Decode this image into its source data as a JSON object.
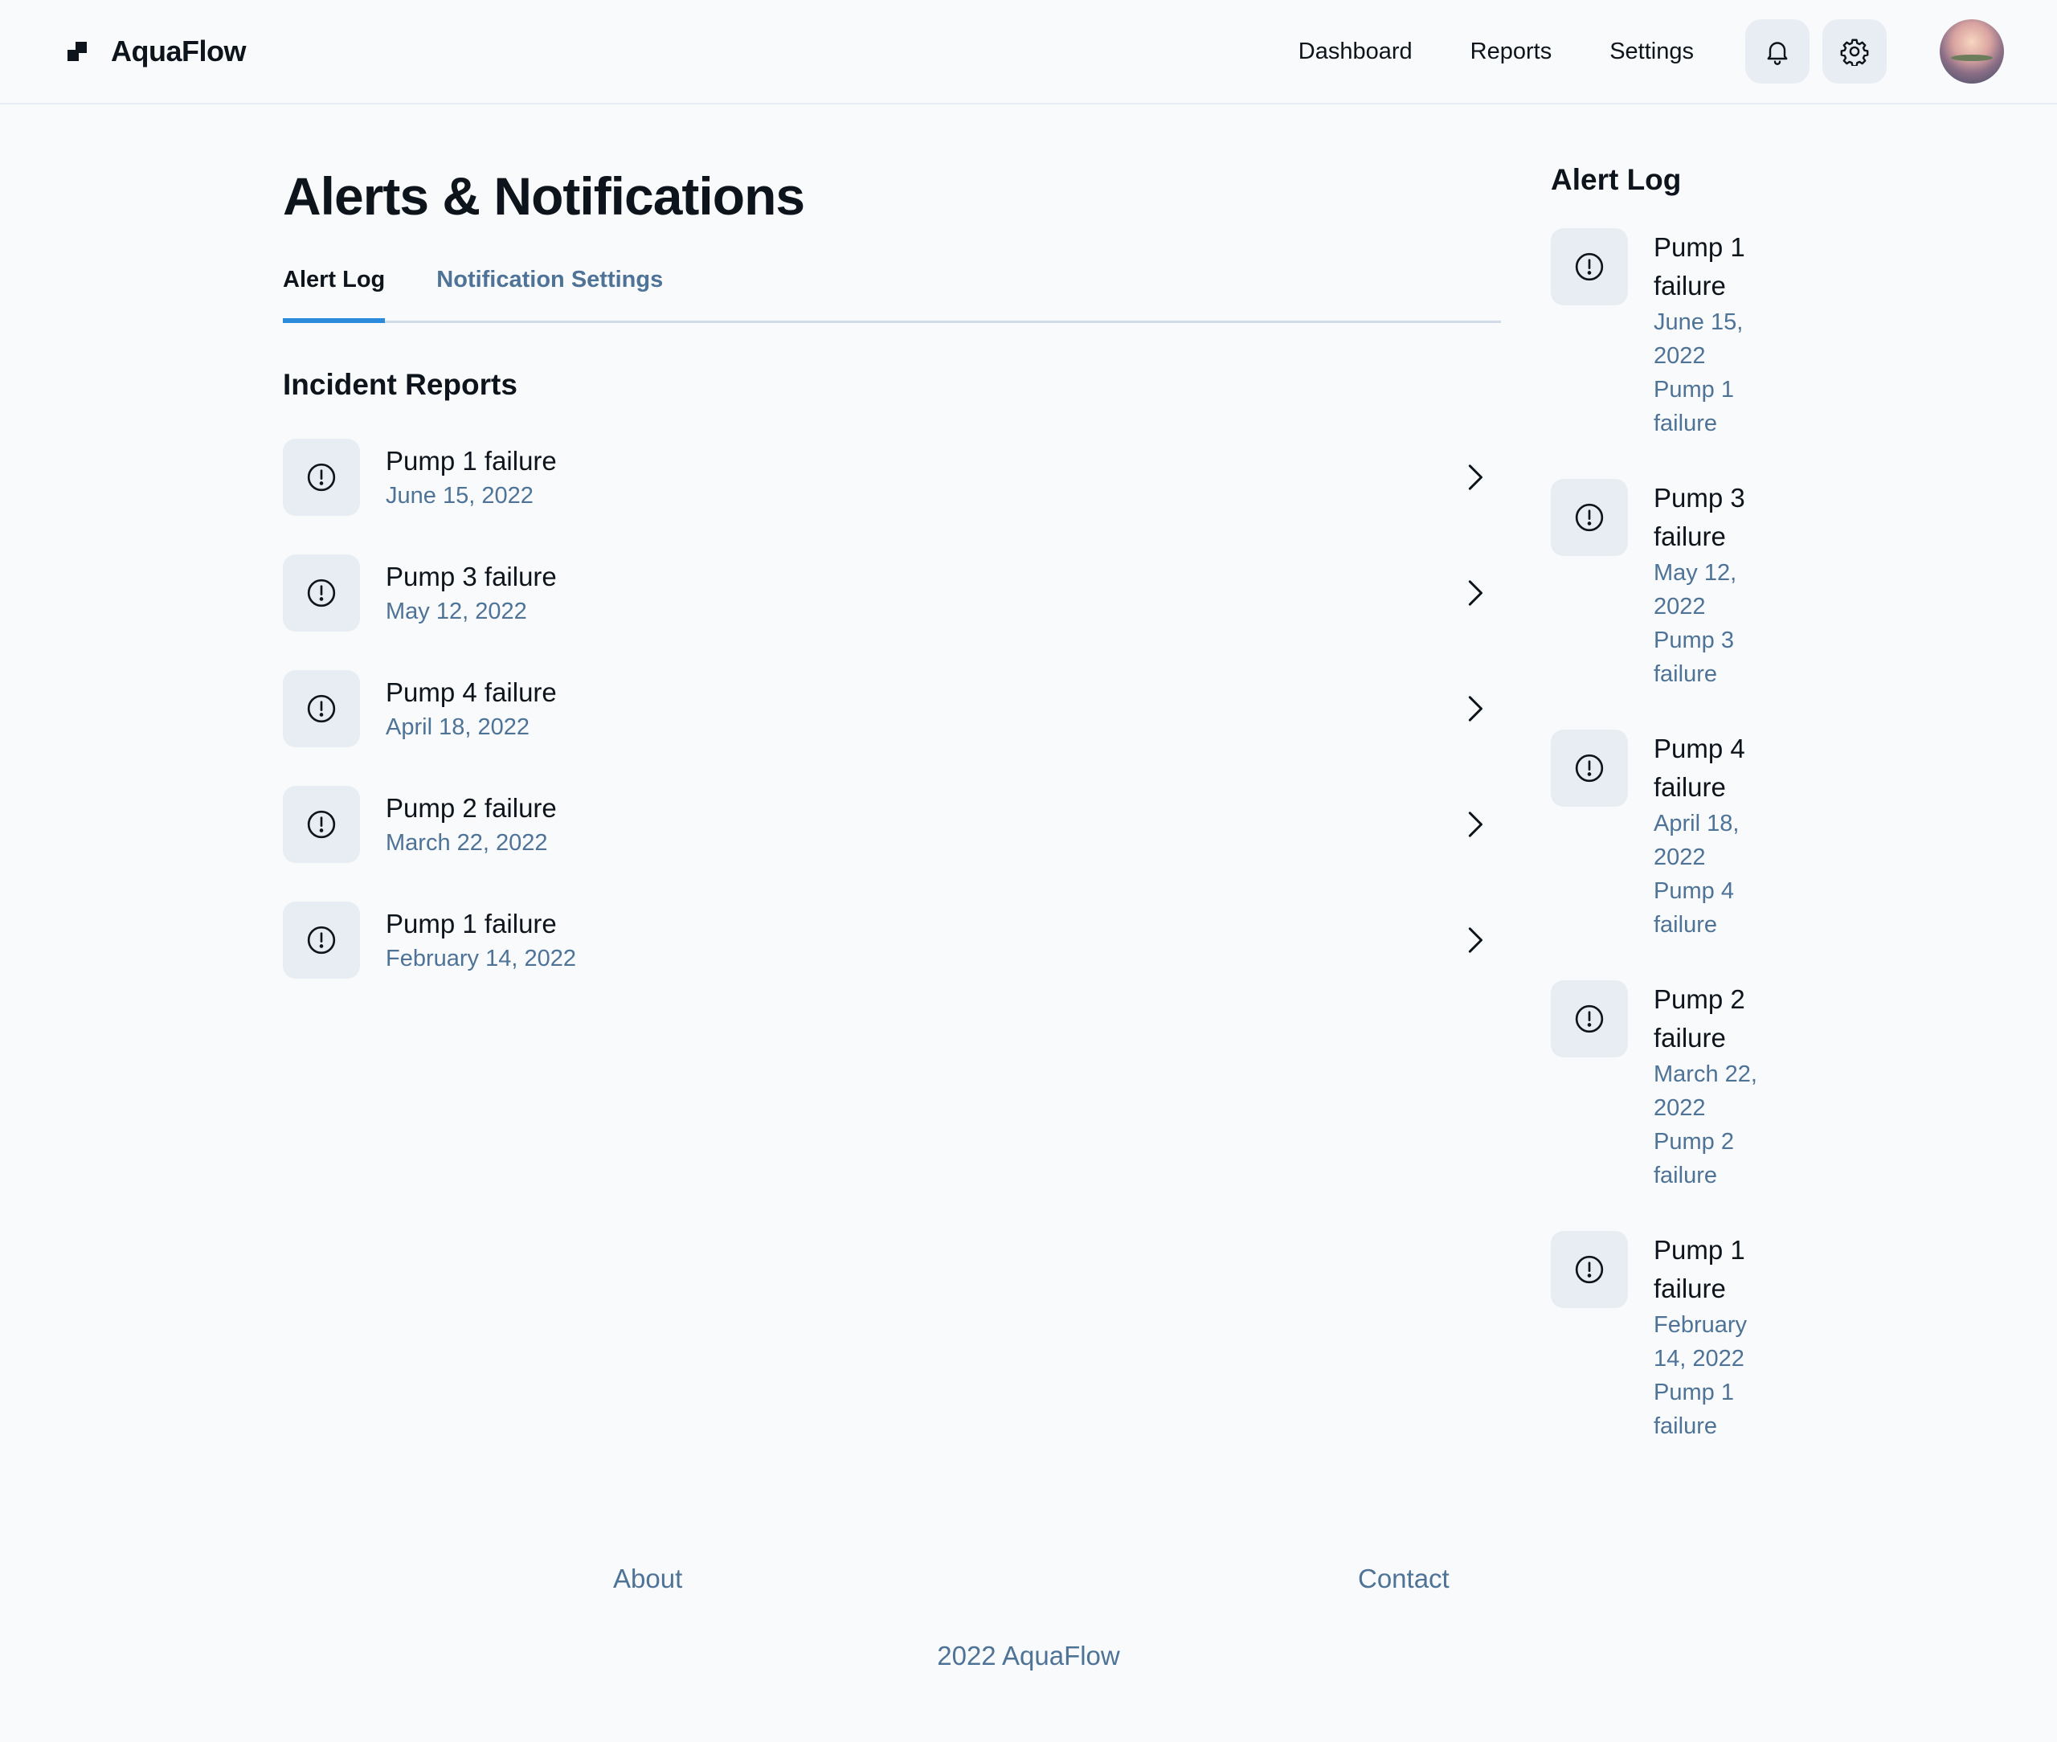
{
  "header": {
    "brand": "AquaFlow",
    "nav": [
      "Dashboard",
      "Reports",
      "Settings"
    ],
    "icons": [
      "bell-icon",
      "gear-icon"
    ]
  },
  "page": {
    "title": "Alerts & Notifications",
    "tabs": [
      {
        "label": "Alert Log",
        "active": true
      },
      {
        "label": "Notification Settings",
        "active": false
      }
    ],
    "section_title": "Incident Reports",
    "incidents": [
      {
        "title": "Pump 1 failure",
        "date": "June 15, 2022"
      },
      {
        "title": "Pump 3 failure",
        "date": "May 12, 2022"
      },
      {
        "title": "Pump 4 failure",
        "date": "April 18, 2022"
      },
      {
        "title": "Pump 2 failure",
        "date": "March 22, 2022"
      },
      {
        "title": "Pump 1 failure",
        "date": "February 14, 2022"
      }
    ]
  },
  "sidebar": {
    "title": "Alert Log",
    "items": [
      {
        "name": "Pump 1 failure",
        "date": "June 15, 2022",
        "desc": "Pump 1 failure"
      },
      {
        "name": "Pump 3 failure",
        "date": "May 12, 2022",
        "desc": "Pump 3 failure"
      },
      {
        "name": "Pump 4 failure",
        "date": "April 18, 2022",
        "desc": "Pump 4 failure"
      },
      {
        "name": "Pump 2 failure",
        "date": "March 22, 2022",
        "desc": "Pump 2 failure"
      },
      {
        "name": "Pump 1 failure",
        "date": "February 14, 2022",
        "desc": "Pump 1 failure"
      }
    ]
  },
  "footer": {
    "links": [
      "About",
      "Contact"
    ],
    "copyright": "2022 AquaFlow"
  }
}
